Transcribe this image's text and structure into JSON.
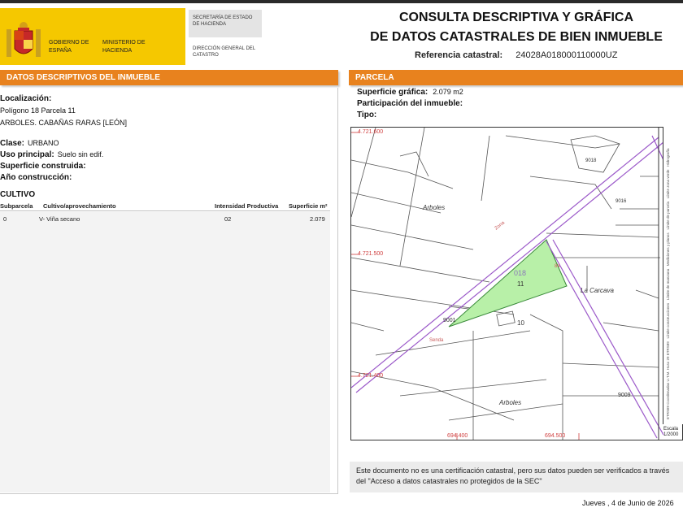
{
  "header": {
    "gobierno": "GOBIERNO DE ESPAÑA",
    "ministerio": "MINISTERIO DE HACIENDA",
    "secretaria": "SECRETARÍA DE ESTADO DE HACIENDA",
    "direccion": "DIRECCIÓN GENERAL DEL CATASTRO",
    "title_line1": "CONSULTA DESCRIPTIVA Y GRÁFICA",
    "title_line2": "DE DATOS CATASTRALES DE BIEN INMUEBLE",
    "ref_label": "Referencia catastral:",
    "ref_value": "24028A018000110000UZ"
  },
  "left": {
    "section_title": "DATOS DESCRIPTIVOS DEL INMUEBLE",
    "localizacion_label": "Localización:",
    "localizacion_line1": "Polígono 18 Parcela 11",
    "localizacion_line2": "ARBOLES. CABAÑAS RARAS [LEÓN]",
    "clase_label": "Clase:",
    "clase_value": "URBANO",
    "uso_label": "Uso principal:",
    "uso_value": "Suelo sin edif.",
    "superficie_label": "Superficie construida:",
    "anio_label": "Año construcción:",
    "cultivo_title": "CULTIVO",
    "table": {
      "headers": [
        "Subparcela",
        "Cultivo/aprovechamiento",
        "Intensidad Productiva",
        "Superficie m²"
      ],
      "rows": [
        [
          "0",
          "V- Viña secano",
          "02",
          "2.079"
        ]
      ]
    }
  },
  "right": {
    "section_title": "PARCELA",
    "superficie_grafica_label": "Superficie gráfica:",
    "superficie_grafica_value": "2.079 m2",
    "participacion_label": "Participación del inmueble:",
    "tipo_label": "Tipo:",
    "map": {
      "parcel_polygon": "018",
      "parcel_number": "11",
      "neighbor_number": "10",
      "place_arboles_1": "Arboles",
      "place_arboles_2": "Arboles",
      "place_carcava": "La Carcava",
      "label_9001": "9001",
      "label_9009": "9009",
      "label_9018": "9018",
      "label_9016": "9016",
      "coord_y1": "4.721.600",
      "coord_y2": "4.721.500",
      "coord_y3": "4.721.400",
      "coord_x1": "694.400",
      "coord_x2": "694.500",
      "escala_label": "Escala",
      "escala_value": "1/2000",
      "legend": [
        "Hidrografía",
        "Límite zona verde",
        "Límite de parcela",
        "Mediciones y planos",
        "Límite de manzana",
        "Límite construcciones",
        "ETRS89 Coordenadas U.T.M. Huso 29 ETRS89"
      ]
    },
    "note": "Este documento no es una certificación catastral, pero sus datos pueden ser verificados a través del \"Acceso a datos catastrales no protegidos de la SEC\"",
    "date": "Jueves , 4 de Junio de 2026"
  },
  "colors": {
    "accent_orange": "#e8821e",
    "header_yellow": "#f5c800",
    "parcel_green": "#b8f0a8",
    "road_purple": "#9b59c9"
  }
}
